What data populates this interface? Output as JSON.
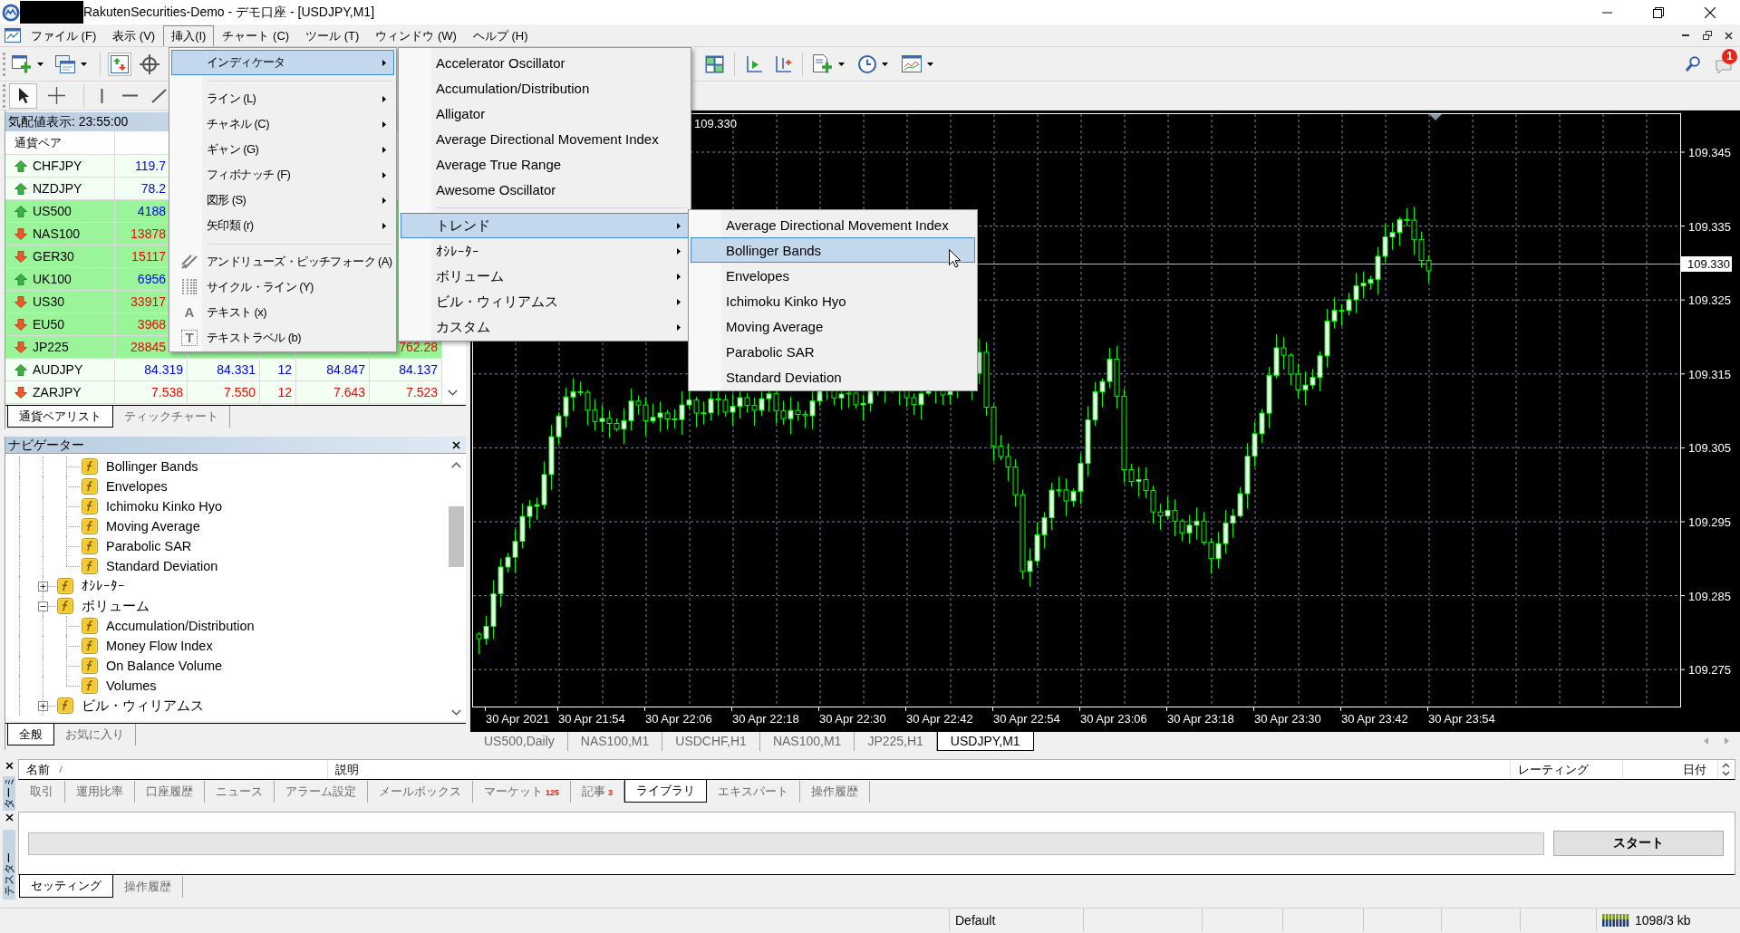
{
  "window": {
    "title": "RakutenSecurities-Demo - デモ口座 - [USDJPY,M1]"
  },
  "menu_bar": [
    {
      "label": "ファイル (F)",
      "selected": false
    },
    {
      "label": "表示 (V)",
      "selected": false
    },
    {
      "label": "挿入(I)",
      "selected": true
    },
    {
      "label": "チャート (C)",
      "selected": false
    },
    {
      "label": "ツール (T)",
      "selected": false
    },
    {
      "label": "ウィンドウ (W)",
      "selected": false
    },
    {
      "label": "ヘルプ (H)",
      "selected": false
    }
  ],
  "toolbar": {
    "left_buttons": [
      {
        "selected": false
      },
      {
        "selected": false
      },
      {
        "selected": true
      },
      {
        "selected": false
      }
    ],
    "right_buttons": [
      {
        "selected": false
      },
      {
        "selected": false
      },
      {
        "selected": false
      },
      {
        "selected": false
      },
      {
        "selected": false
      },
      {
        "selected": false
      }
    ],
    "line_tools": [
      {
        "selected": true
      },
      {
        "selected": false
      },
      {
        "selected": false
      },
      {
        "selected": false
      },
      {
        "selected": false
      }
    ],
    "notification_badge": "1"
  },
  "insert_menu": {
    "groups": [
      [
        {
          "label": "インディケータ",
          "kind": "submenu",
          "selected": true
        }
      ],
      [
        {
          "label": "ライン (L)",
          "kind": "submenu",
          "selected": false
        },
        {
          "label": "チャネル (C)",
          "kind": "submenu",
          "selected": false
        },
        {
          "label": "ギャン (G)",
          "kind": "submenu",
          "selected": false
        },
        {
          "label": "フィボナッチ (F)",
          "kind": "submenu",
          "selected": false
        },
        {
          "label": "図形 (S)",
          "kind": "submenu",
          "selected": false
        },
        {
          "label": "矢印類 (r)",
          "kind": "submenu",
          "selected": false
        }
      ],
      [
        {
          "label": "アンドリューズ・ピッチフォーク (A)",
          "kind": "tool",
          "selected": false
        },
        {
          "label": "サイクル・ライン (Y)",
          "kind": "tool",
          "selected": false
        },
        {
          "label": "テキスト (x)",
          "kind": "glyph",
          "glyph": "A",
          "selected": false
        },
        {
          "label": "テキストラベル (b)",
          "kind": "boxed_glyph",
          "glyph": "T",
          "selected": false
        }
      ]
    ]
  },
  "indicators_menu": {
    "groups": [
      [
        {
          "label": "Accelerator Oscillator",
          "kind": "command",
          "selected": false
        },
        {
          "label": "Accumulation/Distribution",
          "kind": "command",
          "selected": false
        },
        {
          "label": "Alligator",
          "kind": "command",
          "selected": false
        },
        {
          "label": "Average Directional Movement Index",
          "kind": "command",
          "selected": false
        },
        {
          "label": "Average True Range",
          "kind": "command",
          "selected": false
        },
        {
          "label": "Awesome Oscillator",
          "kind": "command",
          "selected": false
        }
      ],
      [
        {
          "label": "トレンド",
          "kind": "submenu",
          "selected": true
        },
        {
          "label": "ｵｼﾚｰﾀｰ",
          "kind": "submenu",
          "selected": false
        },
        {
          "label": "ボリューム",
          "kind": "submenu",
          "selected": false
        },
        {
          "label": "ビル・ウィリアムス",
          "kind": "submenu",
          "selected": false
        },
        {
          "label": "カスタム",
          "kind": "submenu",
          "selected": false
        }
      ]
    ]
  },
  "trend_menu": {
    "items": [
      {
        "label": "Average Directional Movement Index",
        "selected": false
      },
      {
        "label": "Bollinger Bands",
        "selected": true
      },
      {
        "label": "Envelopes",
        "selected": false
      },
      {
        "label": "Ichimoku Kinko Hyo",
        "selected": false
      },
      {
        "label": "Moving Average",
        "selected": false
      },
      {
        "label": "Parabolic SAR",
        "selected": false
      },
      {
        "label": "Standard Deviation",
        "selected": false
      }
    ]
  },
  "market_watch": {
    "title": "気配値表示: 23:55:00",
    "columns": [
      "通貨ペア"
    ],
    "rows": [
      {
        "symbol": "CHFJPY",
        "kind": "up",
        "highlighted": false,
        "column_2": "119.7"
      },
      {
        "symbol": "NZDJPY",
        "kind": "up",
        "highlighted": false,
        "column_2": "78.2"
      },
      {
        "symbol": "US500",
        "kind": "up",
        "highlighted": true,
        "column_2": "4188"
      },
      {
        "symbol": "NAS100",
        "kind": "down",
        "highlighted": true,
        "column_2": "13878"
      },
      {
        "symbol": "GER30",
        "kind": "down",
        "highlighted": true,
        "column_2": "15117"
      },
      {
        "symbol": "UK100",
        "kind": "up",
        "highlighted": true,
        "column_2": "6956"
      },
      {
        "symbol": "US30",
        "kind": "down",
        "highlighted": true,
        "column_2": "33917"
      },
      {
        "symbol": "EU50",
        "kind": "down",
        "highlighted": true,
        "column_2": "3968"
      },
      {
        "symbol": "JP225",
        "kind": "down",
        "highlighted": true,
        "column_2": "28845",
        "column_6": "762.28"
      },
      {
        "symbol": "AUDJPY",
        "kind": "up",
        "highlighted": false,
        "column_2": "84.319",
        "column_3": "84.331",
        "column_4": "12",
        "column_5": "84.847",
        "column_6": "84.137"
      },
      {
        "symbol": "ZARJPY",
        "kind": "down",
        "highlighted": false,
        "column_2": "7.538",
        "column_3": "7.550",
        "column_4": "12",
        "column_5": "7.643",
        "column_6": "7.523"
      }
    ],
    "tabs": [
      {
        "label": "通貨ペアリスト",
        "selected": true
      },
      {
        "label": "ティックチャート",
        "selected": false
      }
    ]
  },
  "navigator": {
    "title": "ナビゲーター",
    "tree": [
      {
        "children": [
          {
            "label": "Bollinger Bands"
          },
          {
            "label": "Envelopes"
          },
          {
            "label": "Ichimoku Kinko Hyo"
          },
          {
            "label": "Moving Average"
          },
          {
            "label": "Parabolic SAR"
          },
          {
            "label": "Standard Deviation"
          }
        ]
      },
      {
        "label": "ｵｼﾚｰﾀｰ",
        "expanded": false
      },
      {
        "label": "ボリューム",
        "expanded": true,
        "children": [
          {
            "label": "Accumulation/Distribution"
          },
          {
            "label": "Money Flow Index"
          },
          {
            "label": "On Balance Volume"
          },
          {
            "label": "Volumes"
          }
        ]
      },
      {
        "label": "ビル・ウィリアムス",
        "expanded": false
      }
    ],
    "tabs": [
      {
        "label": "全般",
        "selected": true
      },
      {
        "label": "お気に入り",
        "selected": false
      }
    ]
  },
  "chart": {
    "info_price": "109.330",
    "price_labels": [
      "109.345",
      "109.335",
      "109.325",
      "109.315",
      "109.305",
      "109.295",
      "109.285",
      "109.275"
    ],
    "current_price": "109.330",
    "time_labels": [
      "30 Apr 2021",
      "30 Apr 21:54",
      "30 Apr 22:06",
      "30 Apr 22:18",
      "30 Apr 22:30",
      "30 Apr 22:42",
      "30 Apr 22:54",
      "30 Apr 23:06",
      "30 Apr 23:18",
      "30 Apr 23:30",
      "30 Apr 23:42",
      "30 Apr 23:54"
    ],
    "tabs": [
      {
        "label": "US500,Daily",
        "selected": false
      },
      {
        "label": "NAS100,M1",
        "selected": false
      },
      {
        "label": "USDCHF,H1",
        "selected": false
      },
      {
        "label": "NAS100,M1",
        "selected": false
      },
      {
        "label": "JP225,H1",
        "selected": false
      },
      {
        "label": "USDJPY,M1",
        "selected": true
      }
    ]
  },
  "terminal": {
    "side_label": "ターミ",
    "columns": [
      "名前",
      "説明",
      "レーティング",
      "日付"
    ],
    "tabs": [
      {
        "label": "取引",
        "selected": false
      },
      {
        "label": "運用比率",
        "selected": false
      },
      {
        "label": "口座履歴",
        "selected": false
      },
      {
        "label": "ニュース",
        "selected": false
      },
      {
        "label": "アラーム設定",
        "selected": false
      },
      {
        "label": "メールボックス",
        "selected": false
      },
      {
        "label": "マーケット",
        "badge": "125",
        "selected": false
      },
      {
        "label": "記事",
        "badge": "3",
        "selected": false
      },
      {
        "label": "ライブラリ",
        "selected": true
      },
      {
        "label": "エキスパート",
        "selected": false
      },
      {
        "label": "操作履歴",
        "selected": false
      }
    ]
  },
  "tester": {
    "side_label": "テスター",
    "button": "スタート",
    "tabs": [
      {
        "label": "セッティング",
        "selected": true
      },
      {
        "label": "操作履歴",
        "selected": false
      }
    ]
  },
  "status_bar": {
    "profile": "Default",
    "traffic": "1098/3 kb"
  }
}
